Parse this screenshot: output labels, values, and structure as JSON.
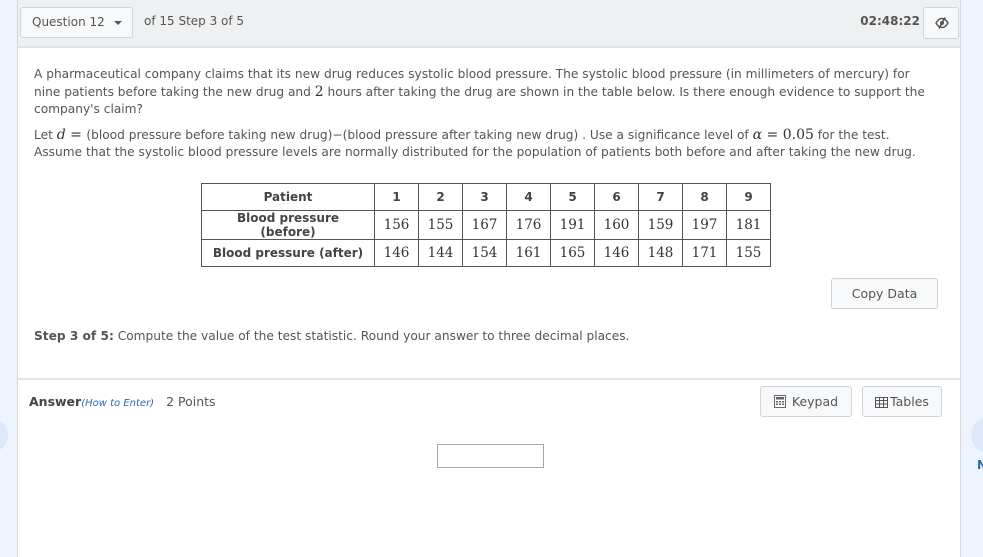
{
  "header": {
    "question_select_label": "Question 12",
    "question_of": "of 15 Step 3 of 5",
    "timer": "02:48:22",
    "toggle_icon": "eye-slash-icon"
  },
  "question": {
    "para1_a": "A pharmaceutical company claims that its new drug reduces systolic blood pressure. The systolic blood pressure (in millimeters of mercury) for nine patients before taking the new drug and ",
    "para1_num": "2",
    "para1_b": " hours after taking the drug are shown in the table below. Is there enough evidence to support the company's claim?",
    "para2_let": "Let ",
    "para2_d": "d",
    "para2_eq": " = ",
    "para2_def": " (blood pressure before taking new drug)−(blood pressure after taking new drug) . Use a significance level of ",
    "para2_alpha": "α",
    "para2_alpha_val": " = 0.05",
    "para2_end": " for the test.",
    "para3": "Assume that the systolic blood pressure levels are normally distributed for the population of patients both before and after taking the new drug."
  },
  "table": {
    "header_label": "Patient",
    "patients": [
      "1",
      "2",
      "3",
      "4",
      "5",
      "6",
      "7",
      "8",
      "9"
    ],
    "rows": [
      {
        "label": "Blood pressure (before)",
        "values": [
          "156",
          "155",
          "167",
          "176",
          "191",
          "160",
          "159",
          "197",
          "181"
        ]
      },
      {
        "label": "Blood pressure (after)",
        "values": [
          "146",
          "144",
          "154",
          "161",
          "165",
          "146",
          "148",
          "171",
          "155"
        ]
      }
    ]
  },
  "copy_data_label": "Copy Data",
  "step": {
    "label": "Step 3 of 5:",
    "text": " Compute the value of the test statistic. Round your answer to three decimal places."
  },
  "answer": {
    "label": "Answer",
    "how_to": "(How to Enter)",
    "points": "2 Points",
    "keypad_label": "Keypad",
    "tables_label": "Tables",
    "input_value": ""
  },
  "nav": {
    "right_label_partial": "N"
  }
}
